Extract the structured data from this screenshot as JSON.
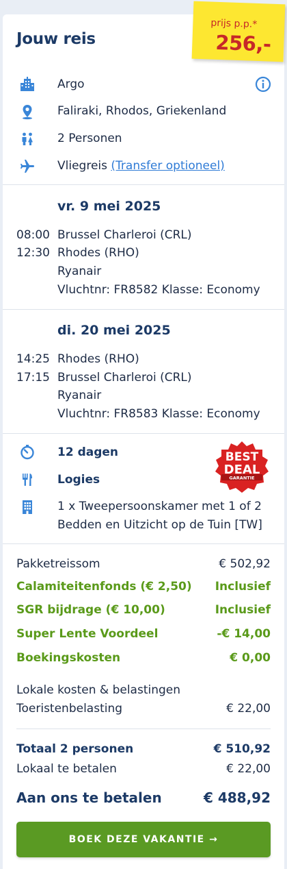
{
  "header": {
    "title": "Jouw reis",
    "price_label": "prijs p.p.*",
    "price_value": "256,-"
  },
  "trip": {
    "hotel": "Argo",
    "location": "Faliraki, Rhodos, Griekenland",
    "persons": "2 Personen",
    "travel_type": "Vliegreis",
    "transfer_link": "(Transfer optioneel)"
  },
  "outbound": {
    "date": "vr. 9 mei 2025",
    "depart_time": "08:00",
    "depart_airport": "Brussel Charleroi (CRL)",
    "arrive_time": "12:30",
    "arrive_airport": "Rhodes (RHO)",
    "airline": "Ryanair",
    "flight_info": "Vluchtnr: FR8582 Klasse: Economy"
  },
  "return": {
    "date": "di. 20 mei 2025",
    "depart_time": "14:25",
    "depart_airport": "Rhodes (RHO)",
    "arrive_time": "17:15",
    "arrive_airport": "Brussel Charleroi (CRL)",
    "airline": "Ryanair",
    "flight_info": "Vluchtnr: FR8583 Klasse: Economy"
  },
  "stay": {
    "duration": "12 dagen",
    "board": "Logies",
    "room_line1": "1 x Tweepersoonskamer met 1 of 2",
    "room_line2": "Bedden en Uitzicht op de Tuin [TW]",
    "badge": {
      "line1": "BEST",
      "line2": "DEAL",
      "line3": "GARANTIE"
    }
  },
  "pricing": {
    "package_label": "Pakketreissom",
    "package_value": "€ 502,92",
    "calamity_label": "Calamiteitenfonds (€ 2,50)",
    "calamity_value": "Inclusief",
    "sgr_label": "SGR bijdrage (€ 10,00)",
    "sgr_value": "Inclusief",
    "discount_label": "Super Lente Voordeel",
    "discount_value": "-€ 14,00",
    "booking_label": "Boekingskosten",
    "booking_value": "€ 0,00",
    "local_heading": "Lokale kosten & belastingen",
    "tourist_tax_label": "Toeristenbelasting",
    "tourist_tax_value": "€ 22,00"
  },
  "totals": {
    "total_label": "Totaal 2 personen",
    "total_value": "€ 510,92",
    "local_label": "Lokaal te betalen",
    "local_value": "€ 22,00",
    "pay_label": "Aan ons te betalen",
    "pay_value": "€ 488,92"
  },
  "cta": {
    "label": "BOEK DEZE VAKANTIE →"
  },
  "colors": {
    "navy": "#1c3a66",
    "icon_blue": "#3a86d8",
    "green": "#5a9a1a",
    "button_green": "#5a9a23",
    "sticker_yellow": "#fde731",
    "sticker_red": "#c62828"
  }
}
